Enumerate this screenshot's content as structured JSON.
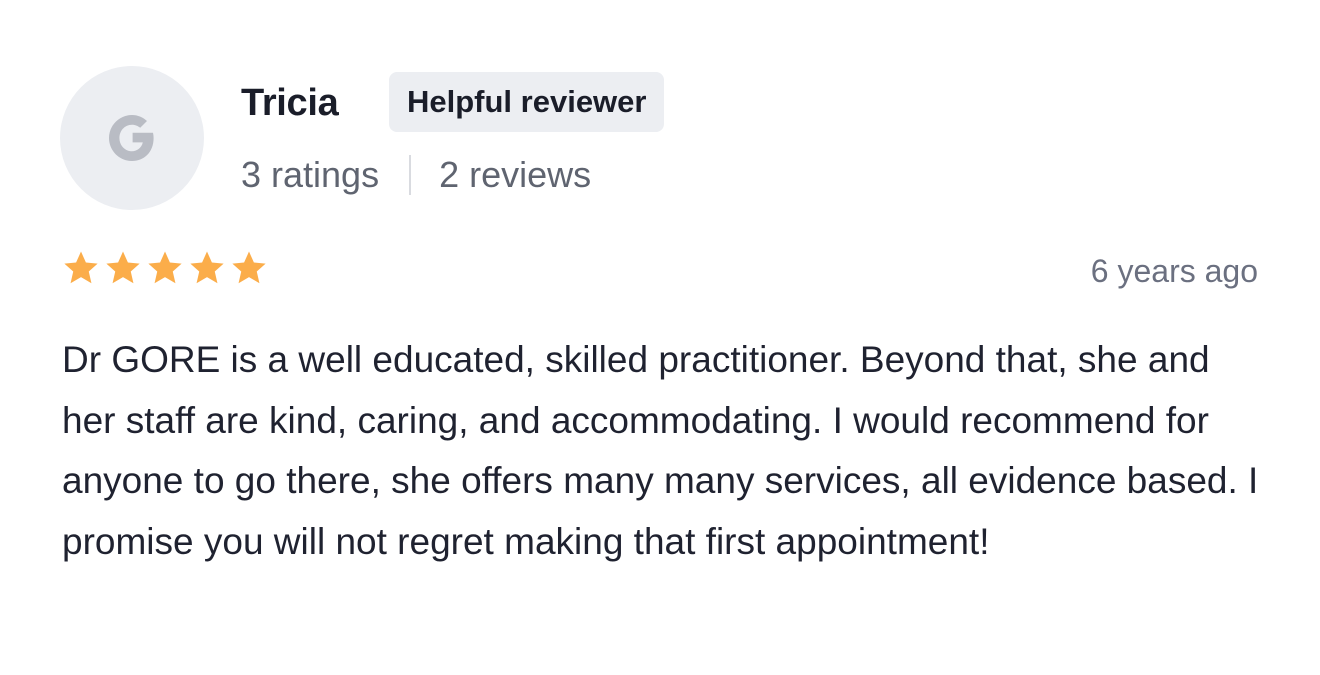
{
  "reviewer": {
    "avatar_letter_icon": "google-g-icon",
    "name": "Tricia",
    "badge": "Helpful reviewer",
    "ratings": "3 ratings",
    "reviews": "2 reviews"
  },
  "review": {
    "rating": 5,
    "rating_max": 5,
    "star_icon": "star-icon",
    "star_color": "#fbad4a",
    "time_ago": "6 years ago",
    "text": "Dr GORE is a well educated, skilled practitioner. Beyond that, she and her staff are kind, caring, and accommodating. I would recommend for anyone to go there, she offers many many services, all evidence based. I promise you will not regret making that first appointment!"
  },
  "colors": {
    "avatar_bg": "#eceef2",
    "avatar_glyph": "#b9bcc4",
    "badge_bg": "#eceef2",
    "text_primary": "#1a1d29",
    "text_secondary": "#5f6470"
  }
}
